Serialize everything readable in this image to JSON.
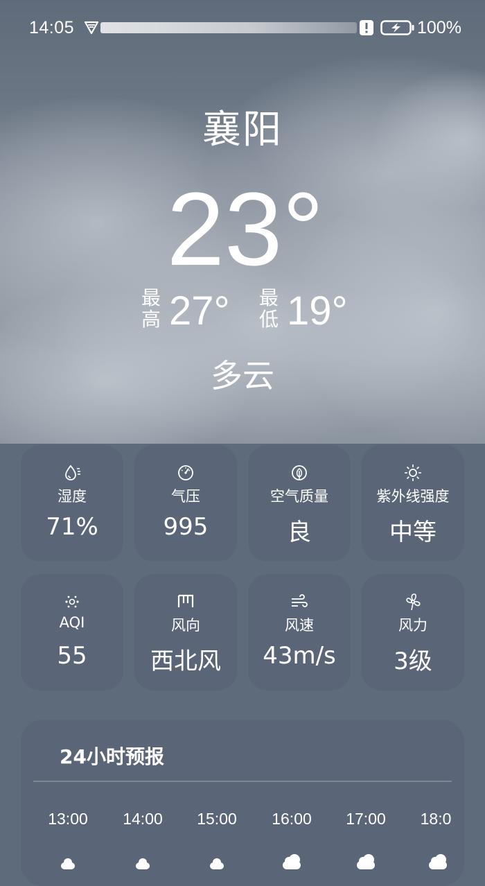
{
  "status_bar": {
    "time": "14:05",
    "battery": "100%"
  },
  "weather": {
    "city": "襄阳",
    "temperature": "23°",
    "high_label": "最高",
    "high": "27°",
    "low_label": "最低",
    "low": "19°",
    "condition": "多云"
  },
  "cards": [
    {
      "icon": "humidity-icon",
      "label": "湿度",
      "value": "71%"
    },
    {
      "icon": "pressure-gauge-icon",
      "label": "气压",
      "value": "995"
    },
    {
      "icon": "leaf-icon",
      "label": "空气质量",
      "value": "良"
    },
    {
      "icon": "sun-icon",
      "label": "紫外线强度",
      "value": "中等"
    },
    {
      "icon": "aqi-dots-icon",
      "label": "AQI",
      "value": "55"
    },
    {
      "icon": "wind-direction-icon",
      "label": "风向",
      "value": "西北风"
    },
    {
      "icon": "wind-speed-icon",
      "label": "风速",
      "value": "43m/s"
    },
    {
      "icon": "fan-icon",
      "label": "风力",
      "value": "3级"
    }
  ],
  "forecast": {
    "title": "24小时预报",
    "hours": [
      {
        "time": "13:00",
        "icon": "cloudy-icon"
      },
      {
        "time": "14:00",
        "icon": "cloudy-icon"
      },
      {
        "time": "15:00",
        "icon": "cloudy-icon"
      },
      {
        "time": "16:00",
        "icon": "cloudy-icon"
      },
      {
        "time": "17:00",
        "icon": "cloudy-icon"
      },
      {
        "time": "18:0",
        "icon": "cloudy-icon"
      }
    ]
  }
}
